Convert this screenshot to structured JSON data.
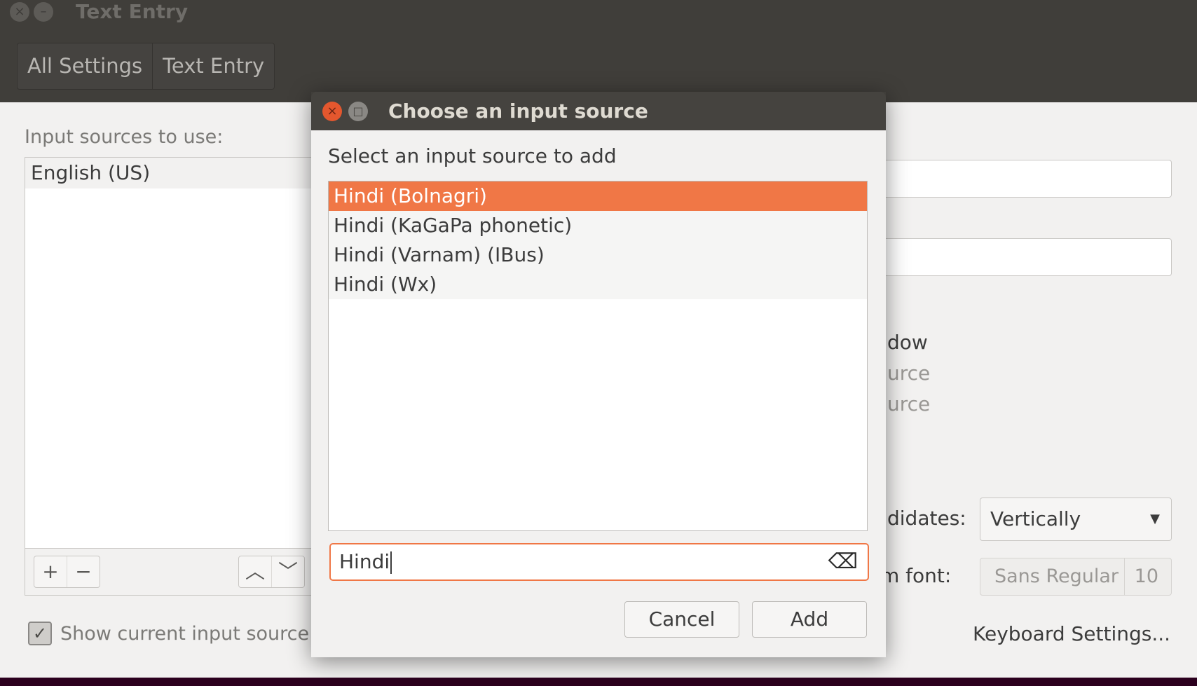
{
  "window": {
    "title": "Text Entry",
    "close_glyph": "×",
    "minimize_glyph": "–"
  },
  "breadcrumbs": [
    "All Settings",
    "Text Entry"
  ],
  "main": {
    "sources_label": "Input sources to use:",
    "sources": [
      "English (US)"
    ],
    "toolbar": {
      "add": "+",
      "remove": "−",
      "up": "︿",
      "down": "﹀"
    },
    "show_current_label": "Show current input source",
    "show_current_checked": true,
    "partial_texts": [
      "dow",
      "urce",
      "urce",
      "didates:",
      "m font:"
    ],
    "candidates_value": "Vertically",
    "custom_font_name": "Sans Regular",
    "custom_font_size": "10",
    "keyboard_settings": "Keyboard Settings..."
  },
  "dialog": {
    "title": "Choose an input source",
    "close_glyph": "×",
    "maximize_glyph": "□",
    "prompt": "Select an input source to add",
    "items": [
      {
        "label": "Hindi (Bolnagri)",
        "selected": true
      },
      {
        "label": "Hindi (KaGaPa phonetic)",
        "selected": false
      },
      {
        "label": "Hindi (Varnam) (IBus)",
        "selected": false
      },
      {
        "label": "Hindi (Wx)",
        "selected": false
      }
    ],
    "search_value": "Hindi",
    "clear_glyph": "⌫",
    "cancel_label": "Cancel",
    "add_label": "Add"
  },
  "colors": {
    "accent": "#f07746",
    "titlebar": "#403e3a",
    "background": "#f2f1f0"
  }
}
